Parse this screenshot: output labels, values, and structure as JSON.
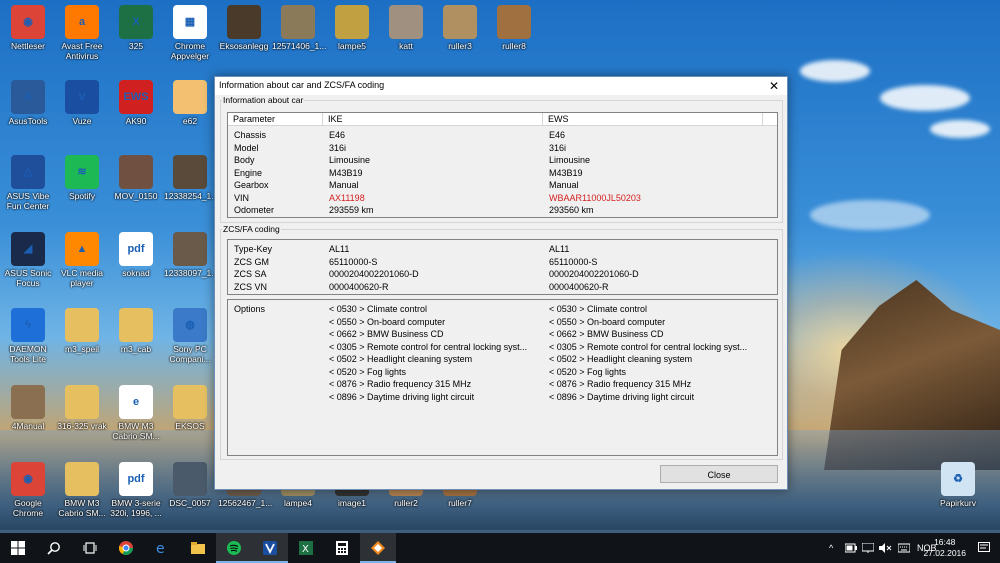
{
  "desktop": {
    "icons": [
      {
        "label": "Nettleser",
        "color": "#db4437",
        "glyph": "◉"
      },
      {
        "label": "Avast Free Antivirus",
        "color": "#ff7800",
        "glyph": "a"
      },
      {
        "label": "325",
        "color": "#1d7044",
        "glyph": "X"
      },
      {
        "label": "Chrome Appvelger",
        "color": "#ffffff",
        "glyph": "▦"
      },
      {
        "label": "Eksosanlegg",
        "color": "#4a3a2a",
        "glyph": ""
      },
      {
        "label": "12571406_1...",
        "color": "#8a7a5a",
        "glyph": ""
      },
      {
        "label": "lampe5",
        "color": "#c0a040",
        "glyph": ""
      },
      {
        "label": "katt",
        "color": "#a09080",
        "glyph": ""
      },
      {
        "label": "ruller3",
        "color": "#b09060",
        "glyph": ""
      },
      {
        "label": "ruller8",
        "color": "#a07040",
        "glyph": ""
      },
      {
        "label": "AsusTools",
        "color": "#2a5a9a",
        "glyph": "A"
      },
      {
        "label": "Vuze",
        "color": "#1a4ea0",
        "glyph": "V"
      },
      {
        "label": "AK90",
        "color": "#d02020",
        "glyph": "EWS"
      },
      {
        "label": "e62",
        "color": "#f2c070",
        "glyph": ""
      },
      {
        "label": "ASUS Vibe Fun Center",
        "color": "#1f4e9a",
        "glyph": "△"
      },
      {
        "label": "Spotify",
        "color": "#1db954",
        "glyph": "≋"
      },
      {
        "label": "MOV_0150",
        "color": "#705040",
        "glyph": ""
      },
      {
        "label": "12338254_1...",
        "color": "#5a4a3a",
        "glyph": ""
      },
      {
        "label": "ASUS Sonic Focus",
        "color": "#1a2a4a",
        "glyph": "◢"
      },
      {
        "label": "VLC media player",
        "color": "#ff8800",
        "glyph": "▲"
      },
      {
        "label": "soknad",
        "color": "#ffffff",
        "glyph": "pdf"
      },
      {
        "label": "12338097_1...",
        "color": "#6a5a4a",
        "glyph": ""
      },
      {
        "label": "DAEMON Tools Lite",
        "color": "#1e6fd8",
        "glyph": "ϟ"
      },
      {
        "label": "m3_speil",
        "color": "#e6c060",
        "glyph": ""
      },
      {
        "label": "m3_cab",
        "color": "#e6c060",
        "glyph": ""
      },
      {
        "label": "Sony PC Compani...",
        "color": "#3a7ac8",
        "glyph": "◍"
      },
      {
        "label": "4Manual",
        "color": "#8a7050",
        "glyph": ""
      },
      {
        "label": "316-325 vrak",
        "color": "#e6c060",
        "glyph": ""
      },
      {
        "label": "BMW M3 Cabrio SM...",
        "color": "#ffffff",
        "glyph": "e"
      },
      {
        "label": "EKSOS",
        "color": "#e6c060",
        "glyph": ""
      },
      {
        "label": "Google Chrome",
        "color": "#db4437",
        "glyph": "◉"
      },
      {
        "label": "BMW M3 Cabrio SM...",
        "color": "#e6c060",
        "glyph": ""
      },
      {
        "label": "BMW 3-serie 320i, 1996, ...",
        "color": "#ffffff",
        "glyph": "pdf"
      },
      {
        "label": "DSC_0057",
        "color": "#4a5a6a",
        "glyph": ""
      },
      {
        "label": "12562467_1...",
        "color": "#6a5a4a",
        "glyph": ""
      },
      {
        "label": "lampe4",
        "color": "#9a8a60",
        "glyph": ""
      },
      {
        "label": "image1",
        "color": "#303030",
        "glyph": ""
      },
      {
        "label": "ruller2",
        "color": "#b08050",
        "glyph": ""
      },
      {
        "label": "ruller7",
        "color": "#a07040",
        "glyph": ""
      },
      {
        "label": "Papirkurv",
        "color": "#d0e4f4",
        "glyph": "♻"
      }
    ]
  },
  "dialog": {
    "title": "Information about car and ZCS/FA coding",
    "close_glyph": "✕",
    "car_group_label": "Information about car",
    "car_headers": [
      "Parameter",
      "IKE",
      "EWS"
    ],
    "car_rows": [
      {
        "param": "Chassis",
        "ike": "E46",
        "ews": "E46",
        "alert": false
      },
      {
        "param": "Model",
        "ike": "316i",
        "ews": "316i",
        "alert": false
      },
      {
        "param": "Body",
        "ike": "Limousine",
        "ews": "Limousine",
        "alert": false
      },
      {
        "param": "Engine",
        "ike": "M43B19",
        "ews": "M43B19",
        "alert": false
      },
      {
        "param": "Gearbox",
        "ike": "Manual",
        "ews": "Manual",
        "alert": false
      },
      {
        "param": "VIN",
        "ike": "AX11198",
        "ews": "WBAAR11000JL50203",
        "alert": true
      },
      {
        "param": "Odometer",
        "ike": "293559 km",
        "ews": "293560 km",
        "alert": false
      }
    ],
    "zcs_group_label": "ZCS/FA coding",
    "zcs_rows": [
      {
        "param": "Type-Key",
        "ike": "AL11",
        "ews": "AL11"
      },
      {
        "param": "ZCS GM",
        "ike": "65110000-S",
        "ews": "65110000-S"
      },
      {
        "param": "ZCS SA",
        "ike": "0000204002201060-D",
        "ews": "0000204002201060-D"
      },
      {
        "param": "ZCS VN",
        "ike": "0000400620-R",
        "ews": "0000400620-R"
      }
    ],
    "options_label": "Options",
    "options": [
      "< 0530 > Climate control",
      "< 0550 > On-board computer",
      "< 0662 > BMW Business CD",
      "< 0305 > Remote control for central locking syst...",
      "< 0502 > Headlight cleaning system",
      "< 0520 > Fog lights",
      "< 0876 > Radio frequency 315 MHz",
      "< 0896 > Daytime driving light circuit"
    ],
    "close_button": "Close",
    "alert_color": "#d41f1f"
  },
  "taskbar": {
    "tray_lang": "NOB",
    "tray_chevron": "^",
    "clock_time": "16:48",
    "clock_date": "27.02.2016"
  }
}
